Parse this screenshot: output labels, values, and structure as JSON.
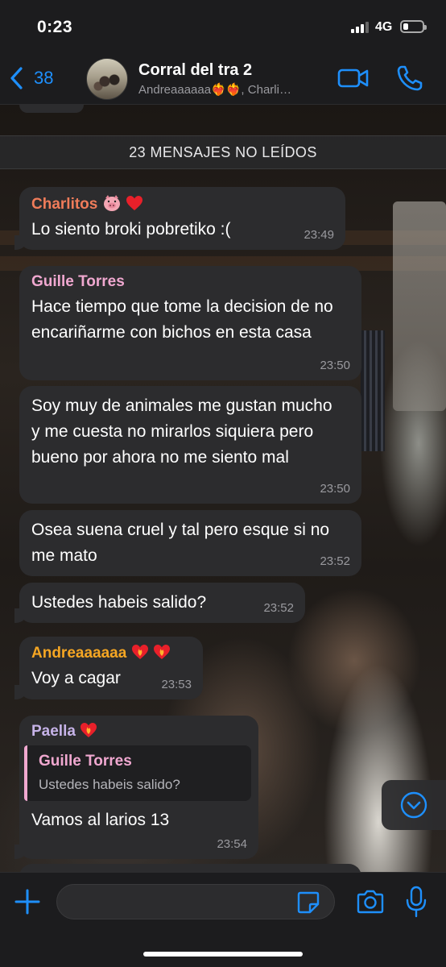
{
  "status_bar": {
    "time": "0:23",
    "network": "4G",
    "signal_bars_active": 3,
    "battery_level": 0.25
  },
  "header": {
    "back_count": "38",
    "title": "Corral del tra 2",
    "subtitle": "Andreaaaaaa❤️‍🔥❤️‍🔥, Charli…",
    "avatar_icon": "group-photo-avatar",
    "video_icon": "video-camera-icon",
    "voice_icon": "phone-icon"
  },
  "unread_banner": "23 MENSAJES NO LEÍDOS",
  "colors": {
    "accent": "#1e8ffc",
    "charlitos": "#f07c5a",
    "guille": "#f0a8d0",
    "andrea": "#f5a623",
    "paella": "#c6b3e8",
    "bubble": "#2c2c2e"
  },
  "messages": [
    {
      "sender": "Charlitos",
      "sender_emoji": [
        "pig-face-icon",
        "red-heart-icon"
      ],
      "text": "Lo siento broki pobretiko :(",
      "time": "23:49"
    },
    {
      "sender": "Guille Torres",
      "text": "Hace tiempo que tome la decision de no encariñarme con bichos en esta casa",
      "time": "23:50"
    },
    {
      "text": "Soy muy de animales me gustan mucho y me cuesta no mirarlos siquiera pero bueno por ahora no me siento mal",
      "time": "23:50"
    },
    {
      "text": "Osea suena cruel y tal pero esque si no me mato",
      "time": "23:52"
    },
    {
      "text": "Ustedes habeis salido?",
      "time": "23:52"
    },
    {
      "sender": "Andreaaaaaa",
      "sender_emoji": [
        "heart-on-fire-icon",
        "heart-on-fire-icon"
      ],
      "text": "Voy a cagar",
      "time": "23:53"
    },
    {
      "sender": "Paella",
      "sender_emoji": [
        "heart-on-fire-icon"
      ],
      "quote": {
        "sender": "Guille Torres",
        "text": "Ustedes habeis salido?"
      },
      "text": "Vamos al larios 13",
      "time": "23:54"
    }
  ],
  "composer": {
    "placeholder": "",
    "attach_icon": "plus-icon",
    "sticker_icon": "sticker-icon",
    "camera_icon": "camera-icon",
    "mic_icon": "microphone-icon"
  }
}
